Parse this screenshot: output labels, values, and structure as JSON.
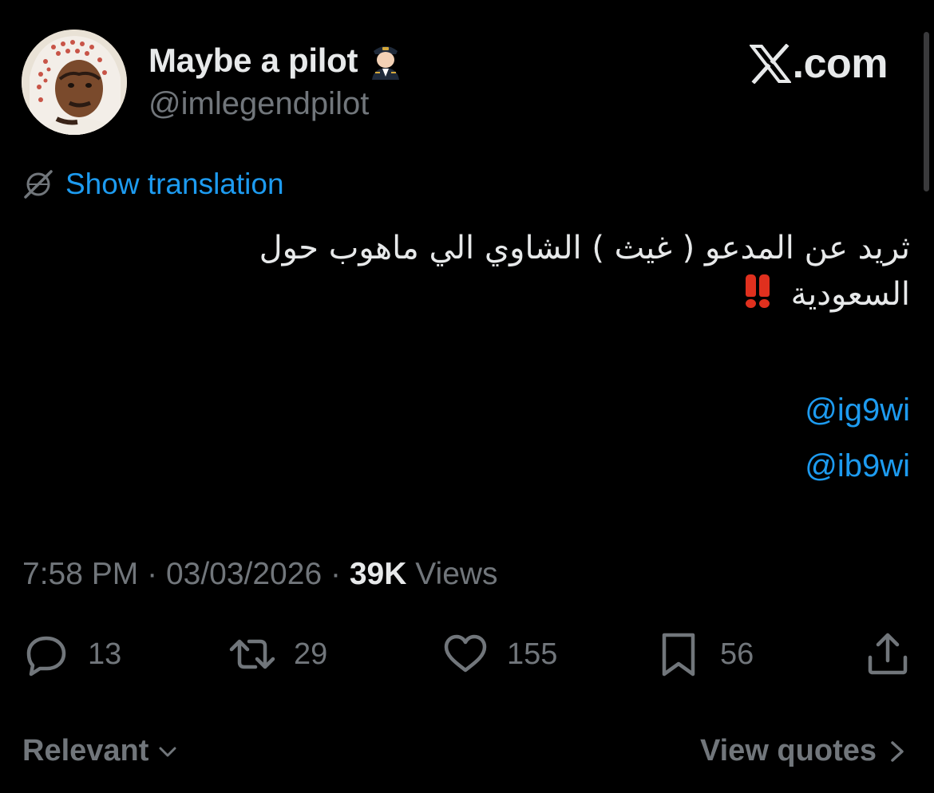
{
  "author": {
    "display_name": "Maybe a pilot",
    "handle": "@imlegendpilot",
    "avatar_icon": "user-avatar-photo",
    "badge_icon": "pilot-emoji-icon"
  },
  "site": {
    "logo_text": ".com",
    "logo_icon": "x-logo-icon"
  },
  "translation": {
    "label": "Show translation",
    "icon": "globe-icon"
  },
  "tweet": {
    "line1": "ثريد عن المدعو ( غيث ) الشاوي الي ماهوب حول",
    "line2": "السعودية",
    "emphasis_icon": "double-exclamation-icon",
    "mentions": [
      "@ig9wi",
      "@ib9wi"
    ]
  },
  "meta": {
    "time": "7:58 PM",
    "separator": "·",
    "date": "03/03/2026",
    "views_count": "39K",
    "views_label": "Views"
  },
  "actions": {
    "replies": "13",
    "reposts": "29",
    "likes": "155",
    "bookmarks": "56"
  },
  "footer": {
    "sort_label": "Relevant",
    "quotes_label": "View quotes"
  },
  "colors": {
    "background": "#000000",
    "text": "#e7e9ea",
    "secondary": "#71767b",
    "link": "#1d9bf0",
    "emphasis": "#e0301e"
  }
}
